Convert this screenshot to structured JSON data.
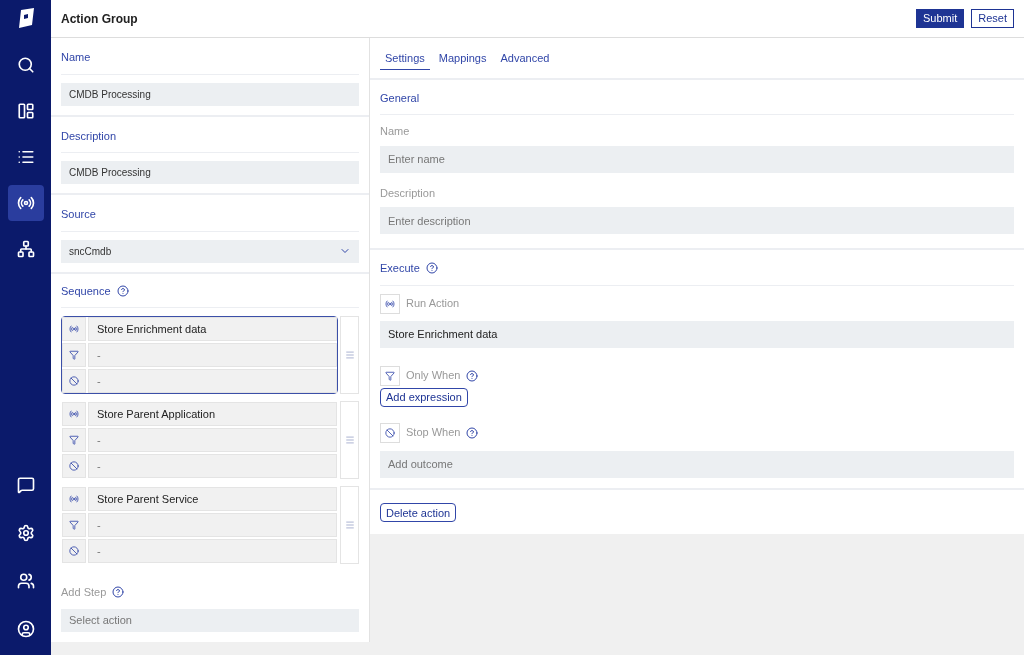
{
  "sidebar": {
    "top_items": [
      {
        "kind": "search",
        "selected": false
      },
      {
        "kind": "layout",
        "selected": false
      },
      {
        "kind": "list",
        "selected": false
      },
      {
        "kind": "broadcast",
        "selected": true
      },
      {
        "kind": "network",
        "selected": false
      }
    ],
    "bottom_items": [
      {
        "kind": "chat",
        "selected": false
      },
      {
        "kind": "settings",
        "selected": false
      },
      {
        "kind": "users",
        "selected": false
      },
      {
        "kind": "profile",
        "selected": false
      }
    ]
  },
  "header": {
    "title": "Action Group",
    "buttons": [
      {
        "label": "Submit",
        "kind": "primary"
      },
      {
        "label": "Reset",
        "kind": "secondary"
      }
    ]
  },
  "form": {
    "name": {
      "label": "Name",
      "value": "CMDB Processing"
    },
    "description": {
      "label": "Description",
      "value": "CMDB Processing"
    },
    "source": {
      "label": "Source",
      "value": "sncCmdb"
    },
    "sequence": {
      "label": "Sequence",
      "steps": [
        {
          "action": "Store Enrichment data",
          "condition": "-",
          "stop": "-",
          "selected": true
        },
        {
          "action": "Store Parent Application",
          "condition": "-",
          "stop": "-",
          "selected": false
        },
        {
          "action": "Store Parent Service",
          "condition": "-",
          "stop": "-",
          "selected": false
        }
      ]
    },
    "add_step": {
      "label": "Add Step",
      "placeholder": "Select action"
    }
  },
  "detail": {
    "tabs": [
      {
        "label": "Settings",
        "selected": true
      },
      {
        "label": "Mappings",
        "selected": false
      },
      {
        "label": "Advanced",
        "selected": false
      }
    ],
    "general": {
      "title": "General",
      "fields": [
        {
          "label": "Name",
          "placeholder": "Enter name"
        },
        {
          "label": "Description",
          "placeholder": "Enter description"
        }
      ]
    },
    "execute": {
      "title": "Execute",
      "run_action": {
        "label": "Run Action",
        "value": "Store Enrichment data"
      },
      "only_when": {
        "label": "Only When",
        "button": "Add expression"
      },
      "stop_when": {
        "label": "Stop When",
        "placeholder": "Add outcome"
      }
    },
    "delete_button": "Delete action"
  }
}
